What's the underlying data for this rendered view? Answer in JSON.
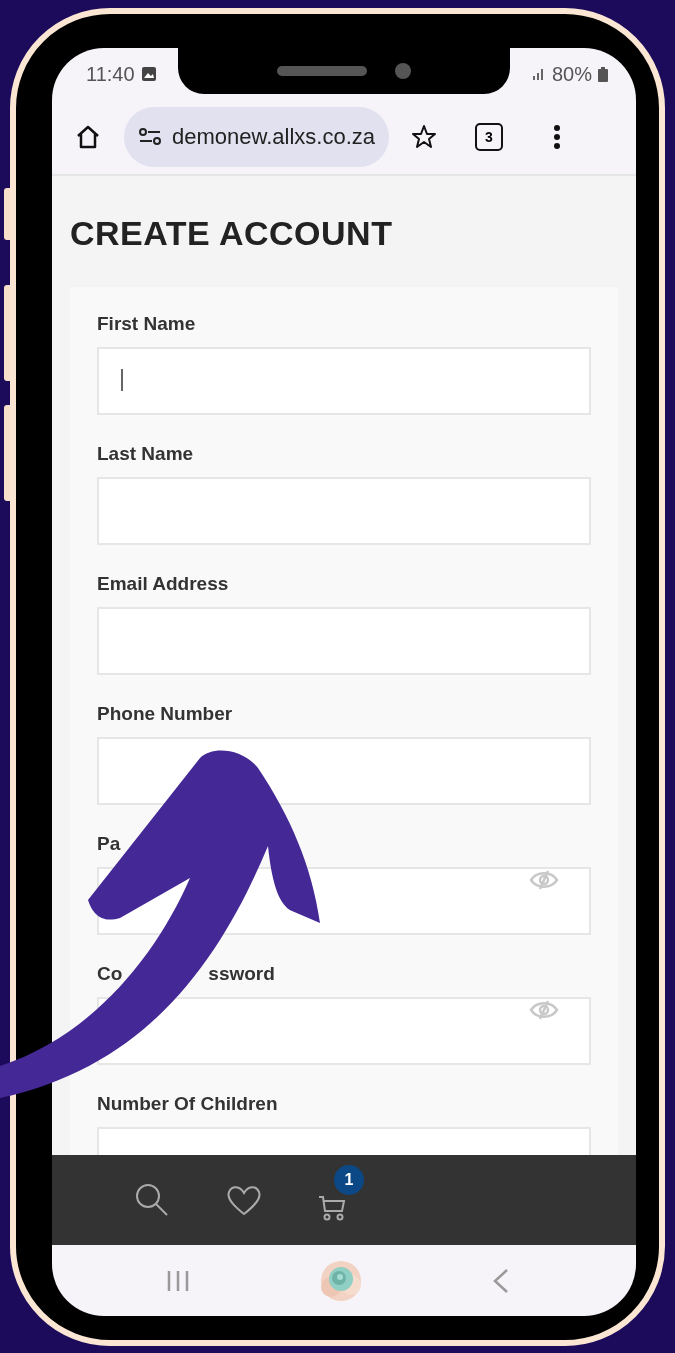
{
  "status_bar": {
    "time": "11:40",
    "battery": "80%"
  },
  "browser": {
    "url": "demonew.allxs.co.za",
    "tab_count": "3"
  },
  "page": {
    "title": "CREATE ACCOUNT",
    "fields": [
      {
        "label_parts": [
          "First Name"
        ],
        "kind": "text",
        "focused": true
      },
      {
        "label_parts": [
          "Last Name"
        ],
        "kind": "text",
        "focused": false
      },
      {
        "label_parts": [
          "Email Address"
        ],
        "kind": "text",
        "focused": false
      },
      {
        "label_parts": [
          "Phone Number"
        ],
        "kind": "text",
        "focused": false
      },
      {
        "label_parts": [
          "Pa"
        ],
        "kind": "password",
        "focused": false
      },
      {
        "label_parts": [
          "Co",
          "ssword"
        ],
        "kind": "password",
        "focused": false
      },
      {
        "label_parts": [
          "Number Of Children"
        ],
        "kind": "text",
        "focused": false
      }
    ]
  },
  "bottom_nav": {
    "cart_count": "1"
  }
}
